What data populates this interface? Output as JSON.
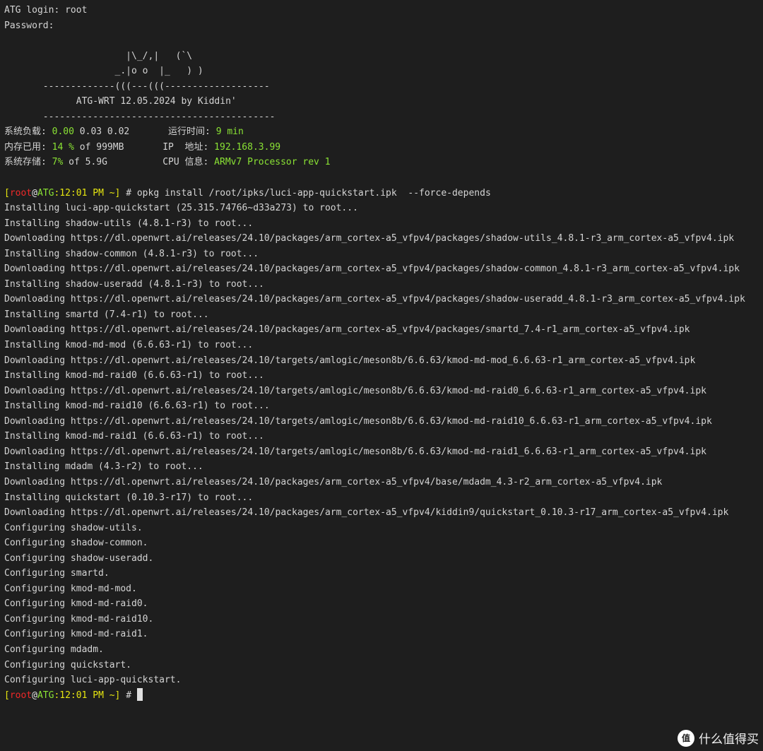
{
  "login": {
    "prompt": "ATG login: root",
    "password": "Password:"
  },
  "banner": {
    "art": [
      "                      |\\_/,|   (`\\",
      "                    _.|o o  |_   ) )",
      "       -------------(((---(((-------------------",
      "             ATG-WRT 12.05.2024 by Kiddin'",
      "       ------------------------------------------"
    ]
  },
  "sysinfo": {
    "load_label": "系统负载: ",
    "load_1": "0.00",
    "load_rest": " 0.03 0.02       ",
    "uptime_label": "运行时间: ",
    "uptime": "9 min",
    "mem_label": "内存已用: ",
    "mem_pct": "14 %",
    "mem_rest": " of 999MB       ",
    "ip_label": "IP  地址: ",
    "ip": "192.168.3.99",
    "storage_label": "系统存储: ",
    "storage_pct": "7%",
    "storage_rest": " of 5.9G          ",
    "cpu_label": "CPU 信息: ",
    "cpu": "ARMv7 Processor rev 1"
  },
  "prompt": {
    "open": "[",
    "user": "root",
    "at": "@",
    "host": "ATG",
    "time": ":12:01 PM ~",
    "close": "]",
    "symbol": " # "
  },
  "command": "opkg install /root/ipks/luci-app-quickstart.ipk  --force-depends",
  "output": [
    "Installing luci-app-quickstart (25.315.74766~d33a273) to root...",
    "Installing shadow-utils (4.8.1-r3) to root...",
    "Downloading https://dl.openwrt.ai/releases/24.10/packages/arm_cortex-a5_vfpv4/packages/shadow-utils_4.8.1-r3_arm_cortex-a5_vfpv4.ipk",
    "Installing shadow-common (4.8.1-r3) to root...",
    "Downloading https://dl.openwrt.ai/releases/24.10/packages/arm_cortex-a5_vfpv4/packages/shadow-common_4.8.1-r3_arm_cortex-a5_vfpv4.ipk",
    "Installing shadow-useradd (4.8.1-r3) to root...",
    "Downloading https://dl.openwrt.ai/releases/24.10/packages/arm_cortex-a5_vfpv4/packages/shadow-useradd_4.8.1-r3_arm_cortex-a5_vfpv4.ipk",
    "Installing smartd (7.4-r1) to root...",
    "Downloading https://dl.openwrt.ai/releases/24.10/packages/arm_cortex-a5_vfpv4/packages/smartd_7.4-r1_arm_cortex-a5_vfpv4.ipk",
    "Installing kmod-md-mod (6.6.63-r1) to root...",
    "Downloading https://dl.openwrt.ai/releases/24.10/targets/amlogic/meson8b/6.6.63/kmod-md-mod_6.6.63-r1_arm_cortex-a5_vfpv4.ipk",
    "Installing kmod-md-raid0 (6.6.63-r1) to root...",
    "Downloading https://dl.openwrt.ai/releases/24.10/targets/amlogic/meson8b/6.6.63/kmod-md-raid0_6.6.63-r1_arm_cortex-a5_vfpv4.ipk",
    "Installing kmod-md-raid10 (6.6.63-r1) to root...",
    "Downloading https://dl.openwrt.ai/releases/24.10/targets/amlogic/meson8b/6.6.63/kmod-md-raid10_6.6.63-r1_arm_cortex-a5_vfpv4.ipk",
    "Installing kmod-md-raid1 (6.6.63-r1) to root...",
    "Downloading https://dl.openwrt.ai/releases/24.10/targets/amlogic/meson8b/6.6.63/kmod-md-raid1_6.6.63-r1_arm_cortex-a5_vfpv4.ipk",
    "Installing mdadm (4.3-r2) to root...",
    "Downloading https://dl.openwrt.ai/releases/24.10/packages/arm_cortex-a5_vfpv4/base/mdadm_4.3-r2_arm_cortex-a5_vfpv4.ipk",
    "Installing quickstart (0.10.3-r17) to root...",
    "Downloading https://dl.openwrt.ai/releases/24.10/packages/arm_cortex-a5_vfpv4/kiddin9/quickstart_0.10.3-r17_arm_cortex-a5_vfpv4.ipk",
    "Configuring shadow-utils.",
    "Configuring shadow-common.",
    "Configuring shadow-useradd.",
    "Configuring smartd.",
    "Configuring kmod-md-mod.",
    "Configuring kmod-md-raid0.",
    "Configuring kmod-md-raid10.",
    "Configuring kmod-md-raid1.",
    "Configuring mdadm.",
    "Configuring quickstart.",
    "Configuring luci-app-quickstart."
  ],
  "watermark": {
    "logo": "值",
    "text": "什么值得买"
  },
  "colors": {
    "background": "#1e1e1e",
    "text": "#d4d4d4",
    "green": "#8ae234",
    "red": "#ef2929",
    "yellow": "#e5e510"
  }
}
